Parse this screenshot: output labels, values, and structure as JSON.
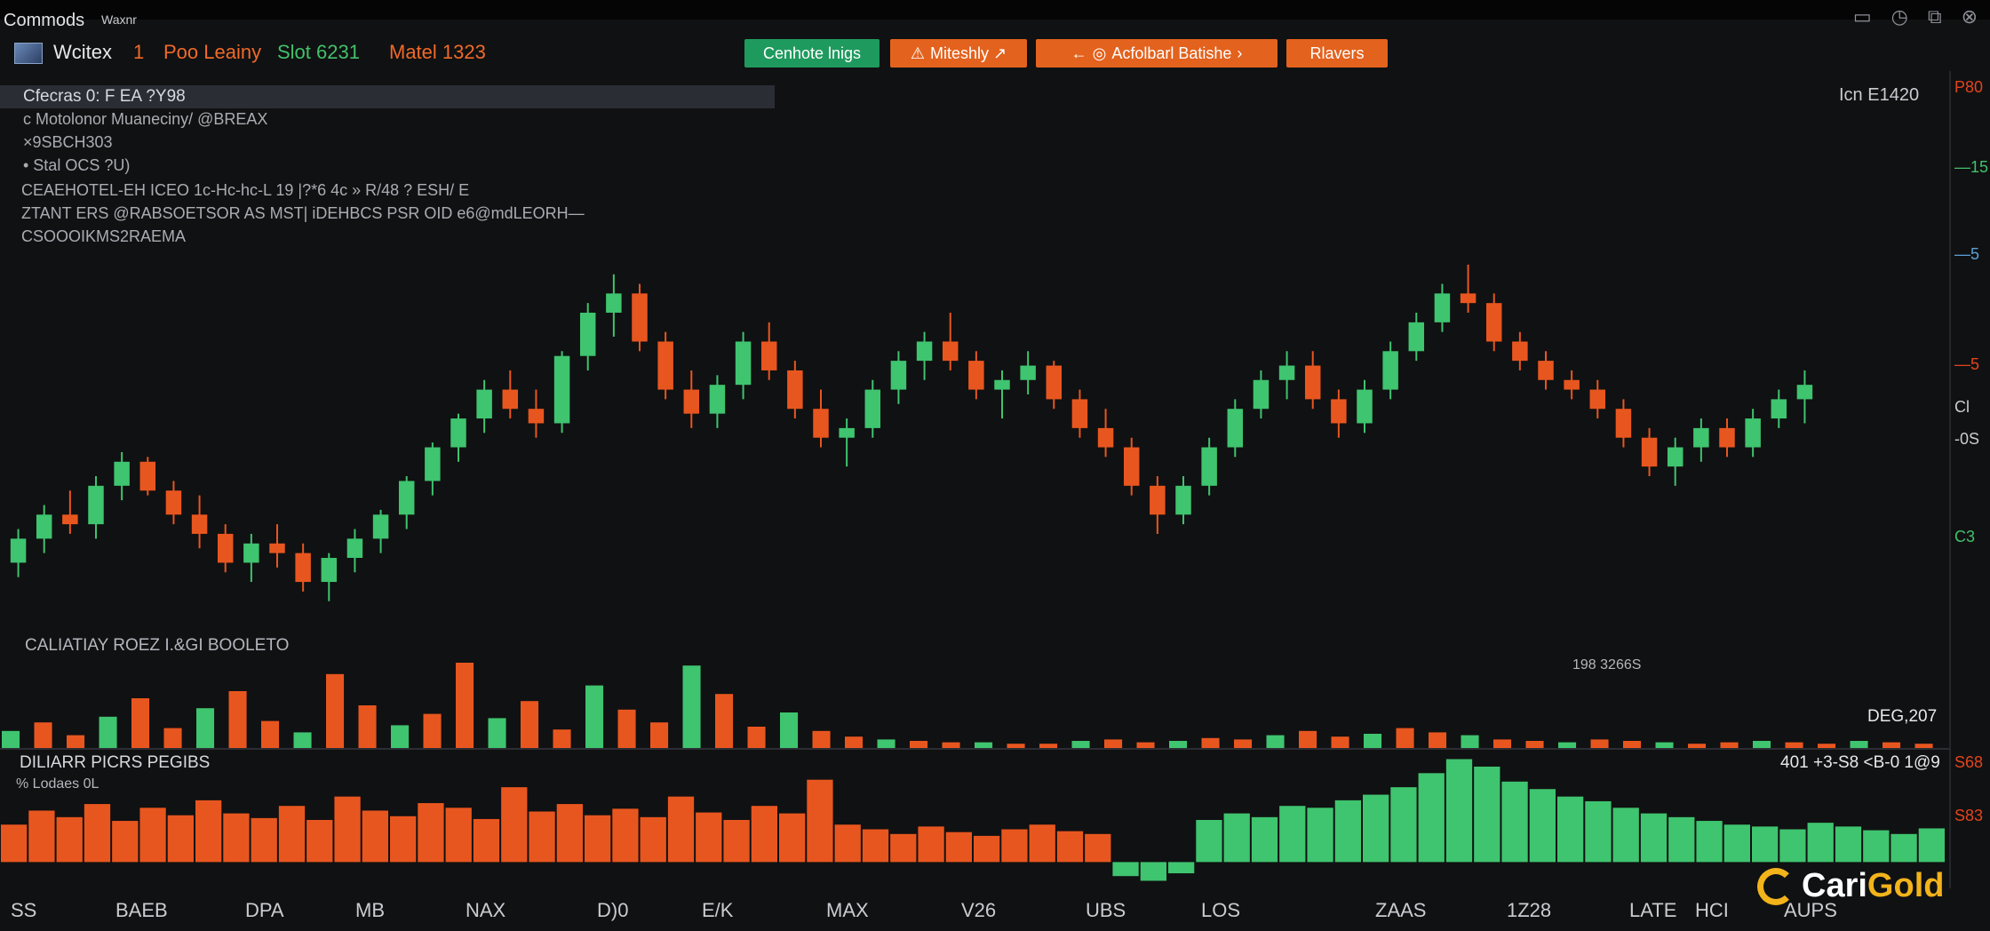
{
  "app": {
    "title": "Commods",
    "subtitle": "Waxnr",
    "window_controls": [
      "minimize-icon",
      "history-icon",
      "restore-icon",
      "close-icon"
    ]
  },
  "toolbar": {
    "symbol": "Wcitex",
    "timeframe": "1",
    "market": "Poo Leainy",
    "stat": "Slot 6231",
    "metal": "Matel 1323",
    "buttons": [
      {
        "label": "Cenhote lnigs",
        "color": "#1f9a5e"
      },
      {
        "label": "Miteshly ↗",
        "color": "#e3621e"
      },
      {
        "label": "Acfolbarl Batishe",
        "color": "#e3621e"
      },
      {
        "label": "Rlavers",
        "color": "#e3621e"
      }
    ]
  },
  "info": {
    "title": "Cfecras 0: F EA ?Y98",
    "lines": [
      "c Motolonor Muaneciny/ @BREAX",
      "×9SBCH303",
      "• Stal OCS ?U)",
      "CEAEHOTEL-EH ICEO 1c-Hc-hc-L 19    |?*6 4c  » R/48 ?   ESH/ E",
      "ZTANT ERS @RABSOETSOR AS MST| iDEHBCS  PSR OID  e6@mdLEORH—",
      "CSOOOIKMS2RAEMA"
    ],
    "price_label": "Icn  E1420"
  },
  "price_axis": [
    {
      "text": "P80",
      "color": "#e3441e"
    },
    {
      "text": "—15",
      "color": "#43c06b"
    },
    {
      "text": "—5",
      "color": "#5aa0d8"
    },
    {
      "text": "—5",
      "color": "#e3441e"
    },
    {
      "text": "Cl",
      "color": "#c9ccd1"
    },
    {
      "text": "-0S",
      "color": "#c9ccd1"
    },
    {
      "text": "C3",
      "color": "#43c06b"
    },
    {
      "text": "S68",
      "color": "#e3441e"
    },
    {
      "text": "S83",
      "color": "#e3441e"
    }
  ],
  "panels": {
    "volume_label": "CALIATIAY ROEZ I.&GI BOOLETO",
    "volume_marker": "198 3266S",
    "volume_value": "DEG,207",
    "hist_label": "DILIARR PICRS PEGIBS",
    "hist_sub": "% Lodaes 0L",
    "hist_value": "401 +3-S8 <B-0 1@9"
  },
  "x_axis": [
    "SS",
    "BAEB",
    "DPA",
    "MB",
    "NAX",
    "D)0",
    "E/K",
    "MAX",
    "V26",
    "UBS",
    "LOS",
    "ZAAS",
    "1Z28",
    "LATE",
    "HCI",
    "AUPS"
  ],
  "brand": {
    "name_a": "Cari",
    "name_b": "Gold"
  },
  "chart_data": [
    {
      "type": "candlestick",
      "title": "",
      "series": [
        {
          "values": [
            [
              56,
              63,
              53,
              61
            ],
            [
              61,
              68,
              58,
              66
            ],
            [
              66,
              71,
              62,
              64
            ],
            [
              64,
              74,
              61,
              72
            ],
            [
              72,
              79,
              69,
              77
            ],
            [
              77,
              78,
              70,
              71
            ],
            [
              71,
              73,
              64,
              66
            ],
            [
              66,
              70,
              59,
              62
            ],
            [
              62,
              64,
              54,
              56
            ],
            [
              56,
              62,
              52,
              60
            ],
            [
              60,
              64,
              55,
              58
            ],
            [
              58,
              60,
              50,
              52
            ],
            [
              52,
              58,
              48,
              57
            ],
            [
              57,
              63,
              54,
              61
            ],
            [
              61,
              67,
              58,
              66
            ],
            [
              66,
              74,
              63,
              73
            ],
            [
              73,
              81,
              70,
              80
            ],
            [
              80,
              87,
              77,
              86
            ],
            [
              86,
              94,
              83,
              92
            ],
            [
              92,
              96,
              86,
              88
            ],
            [
              88,
              92,
              82,
              85
            ],
            [
              85,
              100,
              83,
              99
            ],
            [
              99,
              110,
              96,
              108
            ],
            [
              108,
              116,
              103,
              112
            ],
            [
              112,
              114,
              100,
              102
            ],
            [
              102,
              104,
              90,
              92
            ],
            [
              92,
              96,
              84,
              87
            ],
            [
              87,
              95,
              84,
              93
            ],
            [
              93,
              104,
              90,
              102
            ],
            [
              102,
              106,
              94,
              96
            ],
            [
              96,
              98,
              86,
              88
            ],
            [
              88,
              92,
              80,
              82
            ],
            [
              82,
              86,
              76,
              84
            ],
            [
              84,
              94,
              82,
              92
            ],
            [
              92,
              100,
              89,
              98
            ],
            [
              98,
              104,
              94,
              102
            ],
            [
              102,
              108,
              96,
              98
            ],
            [
              98,
              100,
              90,
              92
            ],
            [
              92,
              96,
              86,
              94
            ],
            [
              94,
              100,
              91,
              97
            ],
            [
              97,
              98,
              88,
              90
            ],
            [
              90,
              92,
              82,
              84
            ],
            [
              84,
              88,
              78,
              80
            ],
            [
              80,
              82,
              70,
              72
            ],
            [
              72,
              74,
              62,
              66
            ],
            [
              66,
              74,
              64,
              72
            ],
            [
              72,
              82,
              70,
              80
            ],
            [
              80,
              90,
              78,
              88
            ],
            [
              88,
              96,
              86,
              94
            ],
            [
              94,
              100,
              90,
              97
            ],
            [
              97,
              100,
              88,
              90
            ],
            [
              90,
              92,
              82,
              85
            ],
            [
              85,
              94,
              83,
              92
            ],
            [
              92,
              102,
              90,
              100
            ],
            [
              100,
              108,
              98,
              106
            ],
            [
              106,
              114,
              104,
              112
            ],
            [
              112,
              118,
              108,
              110
            ],
            [
              110,
              112,
              100,
              102
            ],
            [
              102,
              104,
              96,
              98
            ],
            [
              98,
              100,
              92,
              94
            ],
            [
              94,
              96,
              90,
              92
            ],
            [
              92,
              94,
              86,
              88
            ],
            [
              88,
              90,
              80,
              82
            ],
            [
              82,
              84,
              74,
              76
            ],
            [
              76,
              82,
              72,
              80
            ],
            [
              80,
              86,
              77,
              84
            ],
            [
              84,
              86,
              78,
              80
            ],
            [
              80,
              88,
              78,
              86
            ],
            [
              86,
              92,
              84,
              90
            ],
            [
              90,
              96,
              85,
              93
            ]
          ]
        }
      ],
      "ylim": [
        40,
        125
      ]
    },
    {
      "type": "bar",
      "title": "",
      "values": [
        12,
        18,
        9,
        22,
        35,
        14,
        28,
        40,
        19,
        11,
        52,
        30,
        16,
        24,
        60,
        21,
        33,
        13,
        44,
        27,
        18,
        58,
        38,
        15,
        25,
        12,
        8,
        6,
        5,
        4,
        4,
        3,
        3,
        5,
        6,
        4,
        5,
        7,
        6,
        9,
        12,
        8,
        10,
        14,
        11,
        9,
        6,
        5,
        4,
        6,
        5,
        4,
        3,
        4,
        5,
        4,
        3,
        5,
        4,
        3
      ],
      "ylim": [
        0,
        70
      ]
    },
    {
      "type": "bar",
      "title": "",
      "values": [
        40,
        55,
        48,
        62,
        44,
        58,
        50,
        66,
        52,
        47,
        60,
        45,
        70,
        55,
        49,
        63,
        58,
        46,
        80,
        54,
        62,
        50,
        57,
        48,
        70,
        53,
        45,
        60,
        52,
        88,
        40,
        35,
        30,
        38,
        32,
        28,
        35,
        40,
        33,
        30,
        -15,
        -20,
        -12,
        45,
        52,
        48,
        60,
        58,
        66,
        72,
        80,
        95,
        110,
        102,
        86,
        78,
        70,
        65,
        58,
        52,
        48,
        44,
        40,
        38,
        35,
        42,
        38,
        34,
        30,
        36
      ],
      "ylim": [
        -30,
        120
      ]
    }
  ]
}
